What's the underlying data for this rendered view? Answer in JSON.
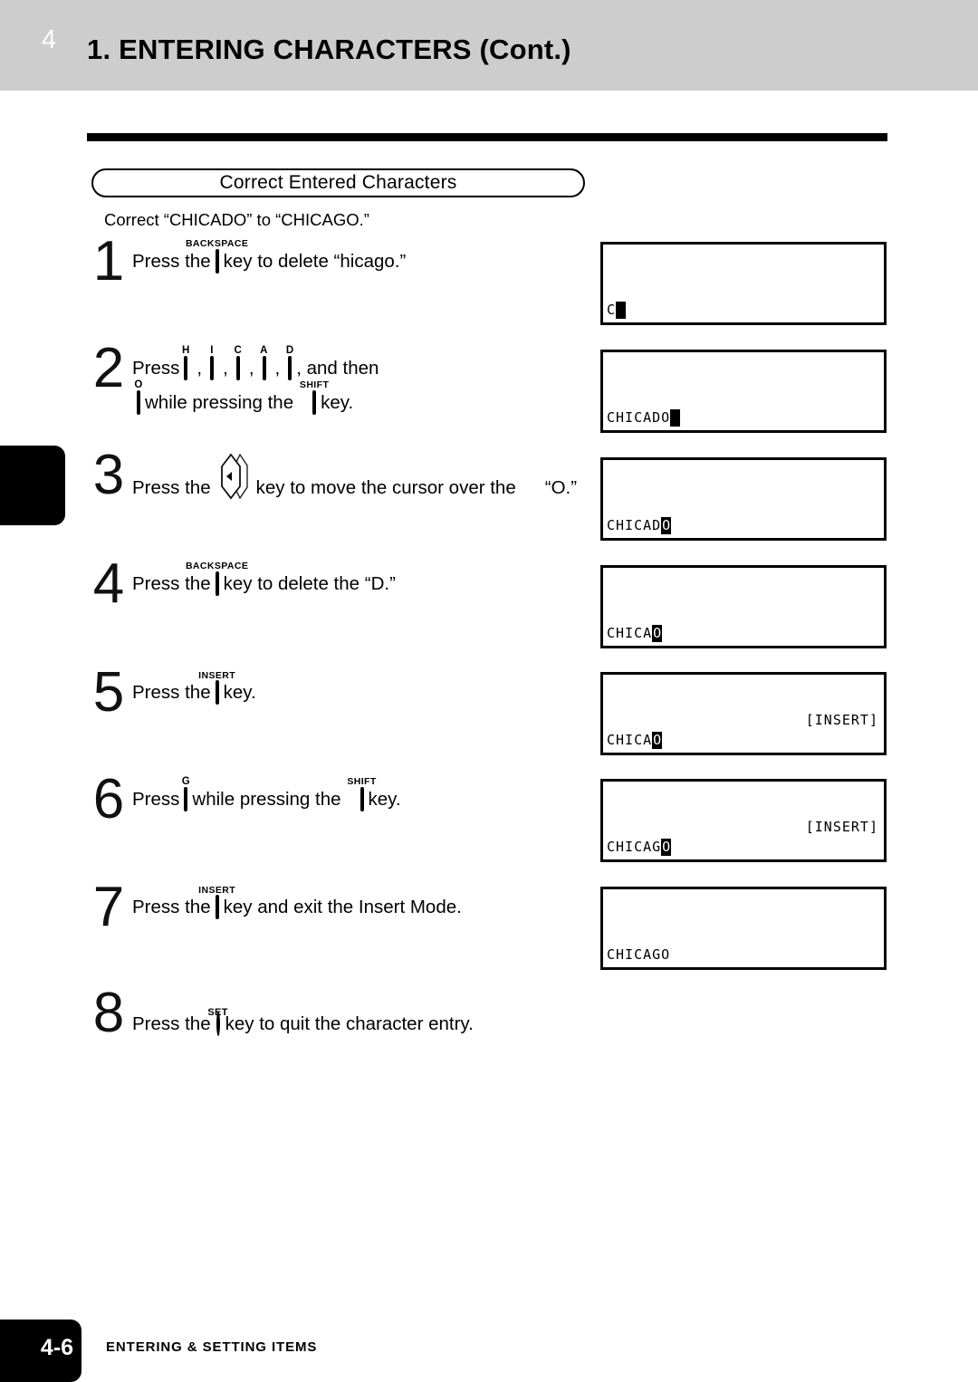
{
  "header": {
    "title": "1. ENTERING CHARACTERS (Cont.)"
  },
  "section": {
    "pill_label": "Correct Entered Characters",
    "intro": "Correct “CHICADO” to “CHICAGO.”"
  },
  "chapter_tab": {
    "number": "4"
  },
  "keys": {
    "backspace": "BACKSPACE",
    "insert": "INSERT",
    "shift": "SHIFT",
    "set": "SET",
    "h": "H",
    "i": "I",
    "c": "C",
    "a": "A",
    "d": "D",
    "o": "O",
    "g": "G",
    "cursor_left": "◄"
  },
  "steps": [
    {
      "number": "1",
      "line1": {
        "pre": "Press the",
        "post": "key to delete “hicago.”"
      }
    },
    {
      "number": "2",
      "line1": {
        "pre": "Press",
        "comma": ",",
        "post": ", and then"
      },
      "line2": {
        "mid": "while pressing the",
        "post": "key."
      }
    },
    {
      "number": "3",
      "line1": {
        "pre": "Press the",
        "post": "key to move the cursor over the",
        "tail": "“O.”"
      }
    },
    {
      "number": "4",
      "line1": {
        "pre": "Press the",
        "post": "key to delete the “D.”"
      }
    },
    {
      "number": "5",
      "line1": {
        "pre": "Press the",
        "post": "key."
      }
    },
    {
      "number": "6",
      "line1": {
        "pre": "Press",
        "mid": "while pressing the",
        "post": "key."
      }
    },
    {
      "number": "7",
      "line1": {
        "pre": "Press the",
        "post": "key and exit the Insert Mode."
      }
    },
    {
      "number": "8",
      "line1": {
        "pre": "Press the",
        "post": "key to quit the character entry."
      }
    }
  ],
  "displays": [
    {
      "mode": "",
      "text": "C",
      "cursor": "",
      "cursor_blank": true
    },
    {
      "mode": "",
      "text": "CHICADO",
      "cursor": "",
      "cursor_blank": true
    },
    {
      "mode": "",
      "text": "CHICAD",
      "cursor": "O",
      "cursor_blank": false
    },
    {
      "mode": "",
      "text": "CHICA",
      "cursor": "O",
      "cursor_blank": false
    },
    {
      "mode": "[INSERT]",
      "text": "CHICA",
      "cursor": "O",
      "cursor_blank": false
    },
    {
      "mode": "[INSERT]",
      "text": "CHICAG",
      "cursor": "O",
      "cursor_blank": false
    },
    {
      "mode": "",
      "text": "CHICAGO",
      "cursor": "",
      "cursor_blank": null
    }
  ],
  "footer": {
    "page_number": "4-6",
    "label": "ENTERING & SETTING ITEMS"
  }
}
